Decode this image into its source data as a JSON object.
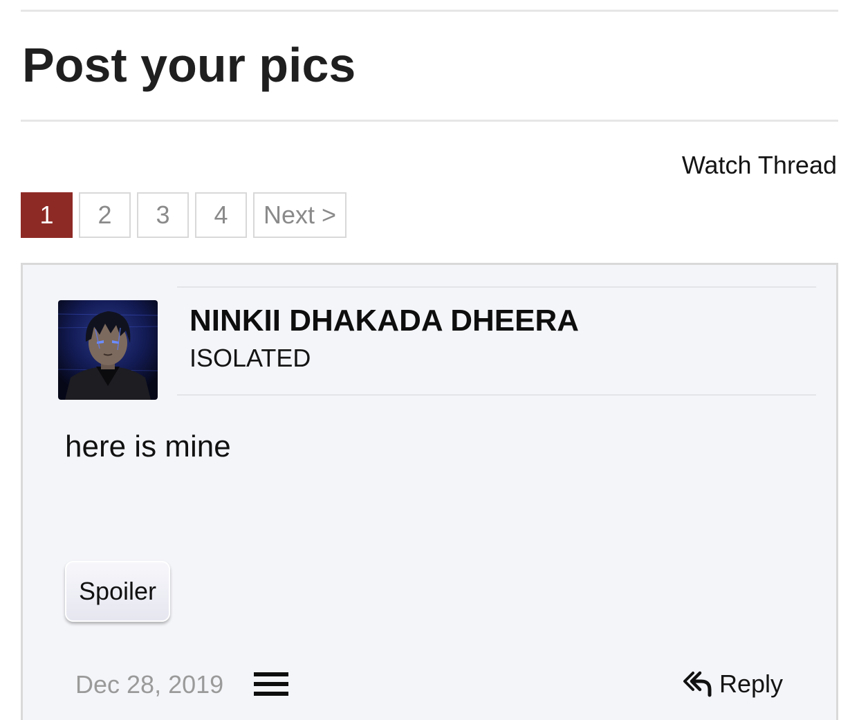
{
  "thread": {
    "title": "Post your pics",
    "watch_label": "Watch Thread"
  },
  "pagination": {
    "pages": [
      "1",
      "2",
      "3",
      "4"
    ],
    "current": "1",
    "next_label": "Next >"
  },
  "post": {
    "author": {
      "name": "NINKII DHAKADA DHEERA",
      "user_title": "ISOLATED",
      "avatar_icon": "anime-character-avatar"
    },
    "body": "here is mine",
    "spoiler_label": "Spoiler",
    "date": "Dec 28, 2019",
    "menu_icon": "hamburger-menu-icon",
    "reply_label": "Reply",
    "reply_icon": "reply-arrow-icon"
  },
  "colors": {
    "active_page": "#8e2a25",
    "post_background": "#f4f5f9",
    "muted_text": "#9a9a9a"
  }
}
